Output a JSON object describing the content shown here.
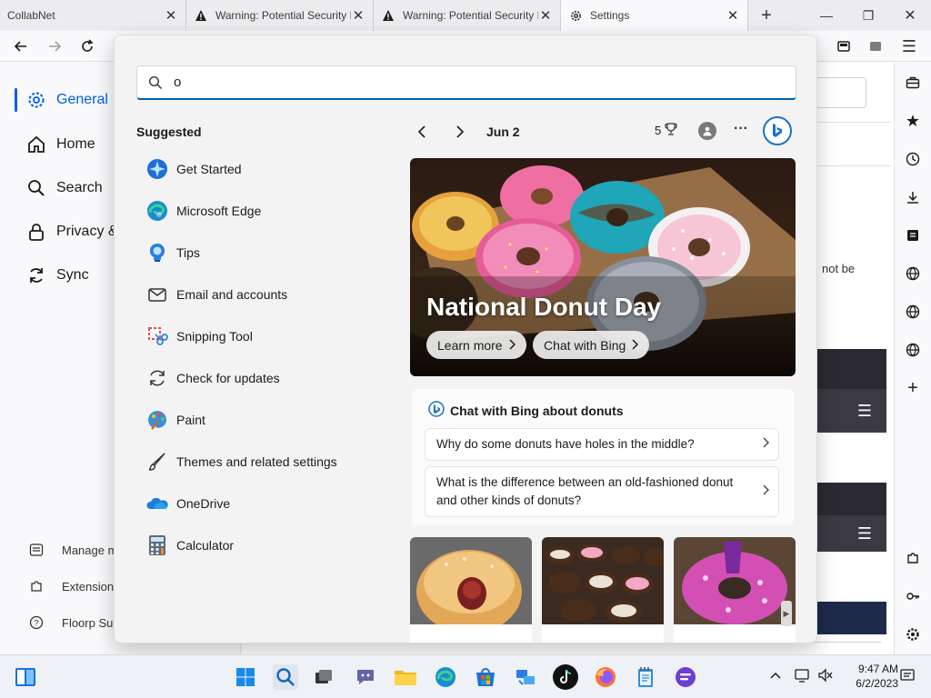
{
  "browser": {
    "tabs": [
      {
        "title": "CollabNet"
      },
      {
        "title": "Warning: Potential Security Risk Ahead"
      },
      {
        "title": "Warning: Potential Security Risk Ahead"
      },
      {
        "title": "Settings"
      }
    ],
    "new_tab_label": "+"
  },
  "settings_nav": {
    "items": [
      {
        "label": "General"
      },
      {
        "label": "Home"
      },
      {
        "label": "Search"
      },
      {
        "label": "Privacy & Security"
      },
      {
        "label": "Sync"
      }
    ],
    "footer": [
      {
        "label": "Manage more settings"
      },
      {
        "label": "Extensions & Themes"
      },
      {
        "label": "Floorp Support"
      }
    ]
  },
  "background_page": {
    "partial_text": "not be"
  },
  "search_flyout": {
    "query": "o",
    "suggested_title": "Suggested",
    "suggestions": [
      {
        "label": "Get Started",
        "icon": "get-started-icon"
      },
      {
        "label": "Microsoft Edge",
        "icon": "edge-icon"
      },
      {
        "label": "Tips",
        "icon": "tips-icon"
      },
      {
        "label": "Email and accounts",
        "icon": "email-icon"
      },
      {
        "label": "Snipping Tool",
        "icon": "snipping-tool-icon"
      },
      {
        "label": "Check for updates",
        "icon": "refresh-icon"
      },
      {
        "label": "Paint",
        "icon": "paint-icon"
      },
      {
        "label": "Themes and related settings",
        "icon": "brush-icon"
      },
      {
        "label": "OneDrive",
        "icon": "onedrive-icon"
      },
      {
        "label": "Calculator",
        "icon": "calculator-icon"
      }
    ],
    "date": "Jun 2",
    "points": "5",
    "hero": {
      "title": "National Donut Day",
      "learn_more": "Learn more",
      "chat_with_bing": "Chat with Bing"
    },
    "chat_card": {
      "title": "Chat with Bing about donuts",
      "questions": [
        "Why do some donuts have holes in the middle?",
        "What is the difference between an old-fashioned donut and other kinds of donuts?"
      ]
    }
  },
  "taskbar": {
    "time": "9:47 AM",
    "date": "6/2/2023"
  },
  "colors": {
    "accent": "#005fb8",
    "firefox_accent": "#0060df",
    "flyout_bg": "#f3f3f3",
    "taskbar_bg": "#eef1f5"
  }
}
